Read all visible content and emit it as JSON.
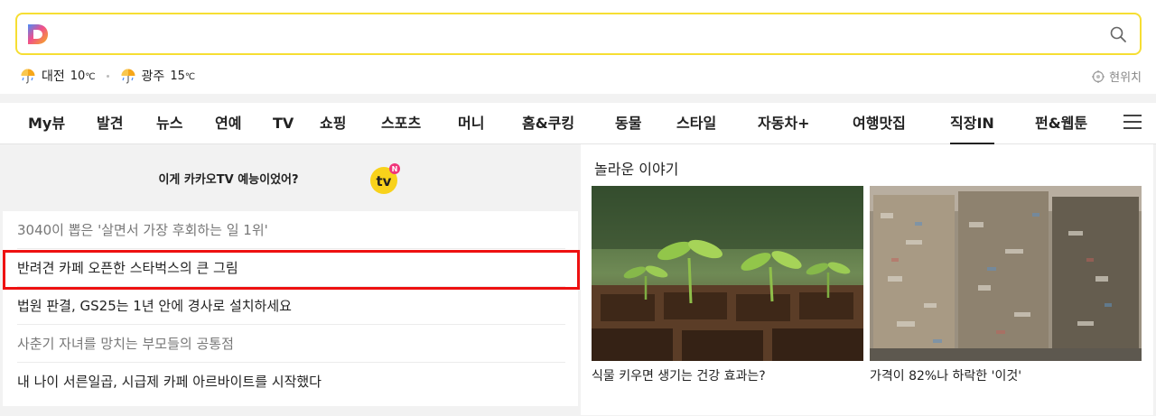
{
  "search": {
    "placeholder": ""
  },
  "weather": [
    {
      "city": "대전",
      "temp": "10",
      "unit": "℃",
      "icon": "rain-umbrella-icon"
    },
    {
      "city": "광주",
      "temp": "15",
      "unit": "℃",
      "icon": "rain-umbrella-icon"
    }
  ],
  "location_label": "현위치",
  "nav": {
    "items": [
      "My뷰",
      "발견",
      "뉴스",
      "연예",
      "TV",
      "쇼핑",
      "스포츠",
      "머니",
      "홈&쿠킹",
      "동물",
      "스타일",
      "자동차+",
      "여행맛집",
      "직장IN",
      "펀&웹툰"
    ],
    "active": "직장IN"
  },
  "promo": {
    "text": "이게 카카오TV 예능이었어?",
    "badge": "N"
  },
  "news": [
    {
      "title": "3040이 뽑은 '살면서 가장 후회하는 일 1위'",
      "style": "gray"
    },
    {
      "title": "반려견 카페 오픈한 스타벅스의 큰 그림",
      "style": "normal"
    },
    {
      "title": "법원 판결, GS25는 1년 안에 경사로 설치하세요",
      "style": "normal"
    },
    {
      "title": "사춘기 자녀를 망치는 부모들의 공통점",
      "style": "gray"
    },
    {
      "title": "내 나이 서른일곱, 시급제 카페 아르바이트를 시작했다",
      "style": "normal"
    }
  ],
  "stories": {
    "title": "놀라운 이야기",
    "cards": [
      {
        "caption": "식물 키우면 생기는 건강 효과는?"
      },
      {
        "caption": "가격이 82%나 하락한 '이것'"
      }
    ]
  },
  "colors": {
    "search_border": "#f6de33",
    "highlight": "#ee1111"
  }
}
